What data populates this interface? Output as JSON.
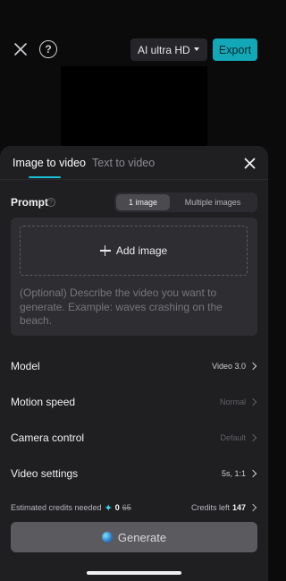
{
  "top": {
    "quality_label": "AI ultra HD",
    "export_label": "Export",
    "help_glyph": "?"
  },
  "sheet": {
    "tabs": [
      {
        "label": "Image to video",
        "active": true
      },
      {
        "label": "Text to video",
        "active": false
      }
    ],
    "prompt": {
      "label": "Prompt",
      "info_glyph": "?",
      "segments": [
        {
          "label": "1 image",
          "selected": true
        },
        {
          "label": "Multiple images",
          "selected": false
        }
      ],
      "add_image_label": "Add image",
      "placeholder": "(Optional) Describe the video you want to generate. Example: waves crashing on the beach."
    },
    "settings": [
      {
        "label": "Model",
        "value": "Video 3.0"
      },
      {
        "label": "Motion speed",
        "value": "Normal"
      },
      {
        "label": "Camera control",
        "value": "Default"
      },
      {
        "label": "Video settings",
        "value": "5s, 1:1"
      }
    ],
    "credits": {
      "estimated_label": "Estimated credits needed",
      "new_value": "0",
      "old_value": "65",
      "left_label": "Credits left",
      "left_value": "147"
    },
    "generate_label": "Generate"
  },
  "colors": {
    "accent": "#12a8b8",
    "tab_underline": "#18c2d6",
    "sheet_bg": "#1f1f22"
  },
  "icons": [
    "close-icon",
    "help-icon",
    "chevron-down-icon",
    "info-icon",
    "plus-icon",
    "chevron-right-icon",
    "sparkle-icon",
    "generate-orb-icon"
  ]
}
